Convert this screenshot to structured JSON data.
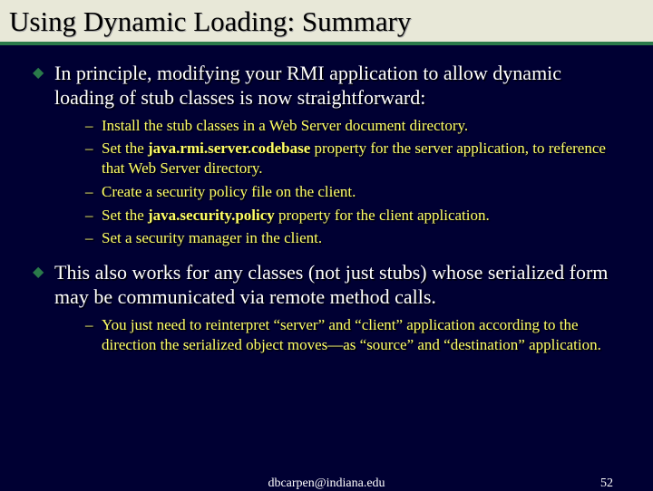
{
  "title": "Using Dynamic Loading: Summary",
  "b1": {
    "text": "In principle, modifying your RMI application to allow dynamic loading of stub classes is now straightforward:",
    "sub": {
      "s1": "Install the stub classes in a Web Server document directory.",
      "s2a": "Set the ",
      "s2b": "java.rmi.server.codebase",
      "s2c": " property for the server application, to reference that Web Server directory.",
      "s3": "Create a security policy file on the client.",
      "s4a": "Set the ",
      "s4b": "java.security.policy",
      "s4c": " property for the client application.",
      "s5": "Set a security manager in the client."
    }
  },
  "b2": {
    "text": "This also works for any classes (not just stubs) whose serialized form may be communicated via remote method calls.",
    "sub": {
      "s1": "You just need to reinterpret “server” and “client” application according to the direction the serialized object moves—as “source” and “destination” application."
    }
  },
  "footer": {
    "email": "dbcarpen@indiana.edu",
    "page": "52"
  }
}
